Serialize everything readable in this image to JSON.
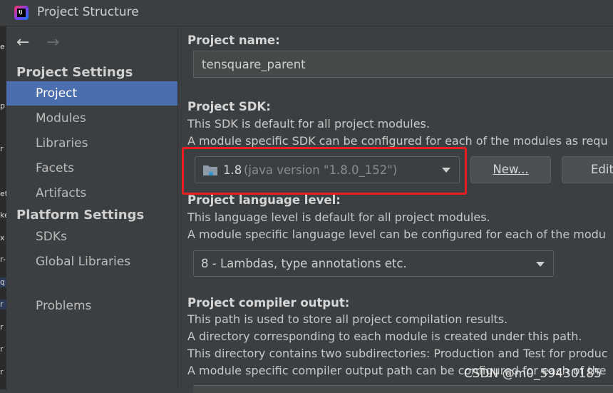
{
  "window": {
    "title": "Project Structure",
    "app_icon_text": "IJ"
  },
  "left_strip": [
    "e",
    "p",
    "r",
    "et",
    "ke",
    "x",
    "r-",
    "q",
    "r",
    "r",
    "r",
    "r"
  ],
  "sidebar": {
    "back_glyph": "←",
    "forward_glyph": "→",
    "project_settings_header": "Project Settings",
    "project_settings_items": [
      "Project",
      "Modules",
      "Libraries",
      "Facets",
      "Artifacts"
    ],
    "platform_settings_header": "Platform Settings",
    "platform_settings_items": [
      "SDKs",
      "Global Libraries"
    ],
    "problems": "Problems"
  },
  "main": {
    "project_name_label": "Project name:",
    "project_name_value": "tensquare_parent",
    "sdk_label": "Project SDK:",
    "sdk_desc1": "This SDK is default for all project modules.",
    "sdk_desc2": "A module specific SDK can be configured for each of the modules as requ",
    "sdk_selected_version": "1.8",
    "sdk_selected_detail": "(java version \"1.8.0_152\")",
    "sdk_new_button": "New...",
    "sdk_edit_button": "Edit",
    "language_label": "Project language level:",
    "language_desc1": "This language level is default for all project modules.",
    "language_desc2": "A module specific language level can be configured for each of the modu",
    "language_selected": "8 - Lambdas, type annotations etc.",
    "compiler_label": "Project compiler output:",
    "compiler_desc1": "This path is used to store all project compilation results.",
    "compiler_desc2": "A directory corresponding to each module is created under this path.",
    "compiler_desc3": "This directory contains two subdirectories: Production and Test for produc",
    "compiler_desc4": "A module specific compiler output path can be configured for each of the"
  },
  "watermark": "CSDN @m0_59430185",
  "colors": {
    "background": "#3c3f41",
    "selection": "#4b6eaf",
    "highlight_box": "#e81f1f"
  }
}
